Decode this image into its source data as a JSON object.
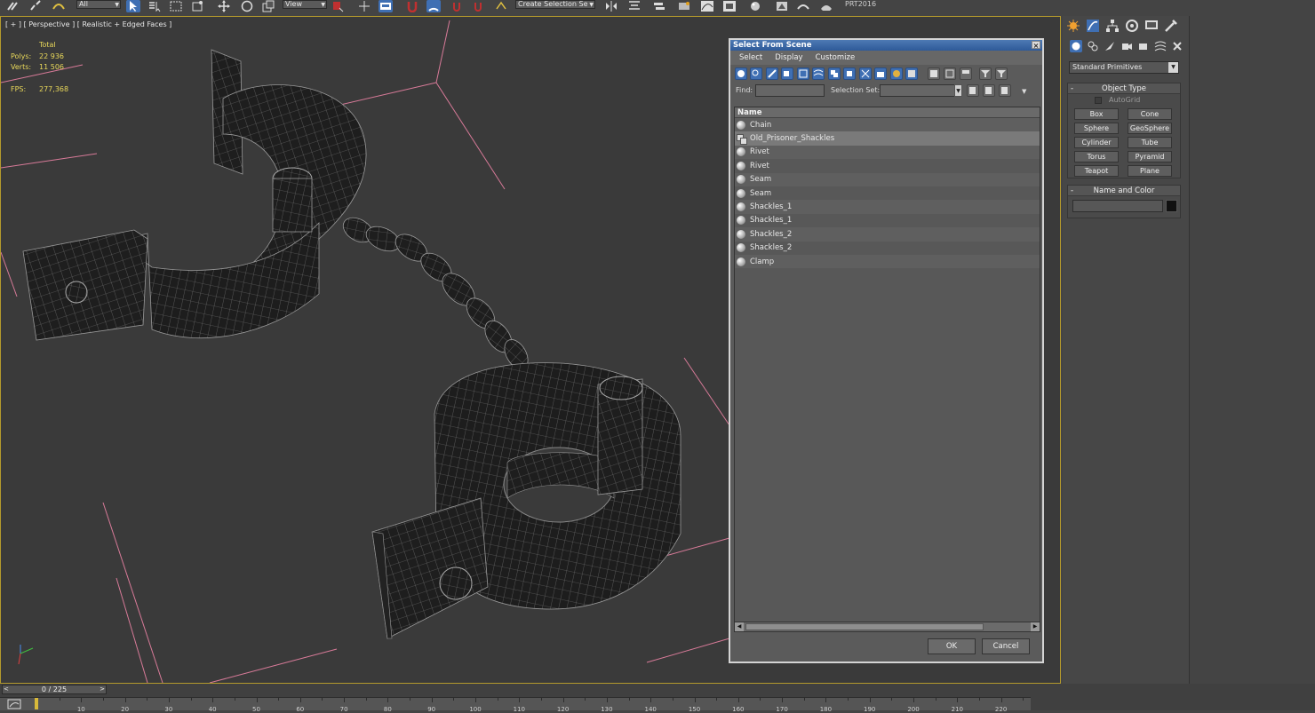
{
  "toolbar": {
    "selection_filter": "All",
    "ref_coord": "View",
    "named_selection_placeholder": "Create Selection Se",
    "prt_label": "PRT2016"
  },
  "viewport": {
    "label": "[ + ] [ Perspective ] [ Realistic + Edged Faces ]",
    "stats": {
      "header": "Total",
      "polys_label": "Polys:",
      "polys_value": "22 936",
      "verts_label": "Verts:",
      "verts_value": "11 506",
      "fps_label": "FPS:",
      "fps_value": "277,368"
    },
    "accent_color": "#b49a2c"
  },
  "dialog": {
    "title": "Select From Scene",
    "close_label": "×",
    "menu": [
      "Select",
      "Display",
      "Customize"
    ],
    "find_label": "Find:",
    "find_value": "",
    "selection_set_label": "Selection Set:",
    "list_header": "Name",
    "items": [
      {
        "name": "Chain",
        "icon": "sphere-object-icon",
        "selected": false
      },
      {
        "name": "Old_Prisoner_Shackles",
        "icon": "group-icon",
        "selected": true
      },
      {
        "name": "Rivet",
        "icon": "sphere-object-icon",
        "selected": false
      },
      {
        "name": "Rivet",
        "icon": "sphere-object-icon",
        "selected": false
      },
      {
        "name": "Seam",
        "icon": "sphere-object-icon",
        "selected": false
      },
      {
        "name": "Seam",
        "icon": "sphere-object-icon",
        "selected": false
      },
      {
        "name": "Shackles_1",
        "icon": "sphere-object-icon",
        "selected": false
      },
      {
        "name": "Shackles_1",
        "icon": "sphere-object-icon",
        "selected": false
      },
      {
        "name": "Shackles_2",
        "icon": "sphere-object-icon",
        "selected": false
      },
      {
        "name": "Shackles_2",
        "icon": "sphere-object-icon",
        "selected": false
      },
      {
        "name": "Clamp",
        "icon": "sphere-object-icon",
        "selected": false
      }
    ],
    "ok_label": "OK",
    "cancel_label": "Cancel",
    "title_color": "#3a66a6"
  },
  "command_panel": {
    "category": "Standard Primitives",
    "object_type": {
      "title": "Object Type",
      "autogrid_label": "AutoGrid",
      "buttons": [
        "Box",
        "Cone",
        "Sphere",
        "GeoSphere",
        "Cylinder",
        "Tube",
        "Torus",
        "Pyramid",
        "Teapot",
        "Plane"
      ]
    },
    "name_and_color": {
      "title": "Name and Color",
      "name_value": "",
      "color": "#111111"
    },
    "collapse_symbol": "-"
  },
  "timeline": {
    "frame_display": "0 / 225",
    "left_arrow": "<",
    "right_arrow": ">",
    "ticks": [
      "10",
      "20",
      "30",
      "40",
      "50",
      "60",
      "70",
      "80",
      "90",
      "100",
      "110",
      "120",
      "130",
      "140",
      "150",
      "160",
      "170",
      "180",
      "190",
      "200",
      "210",
      "220"
    ]
  }
}
